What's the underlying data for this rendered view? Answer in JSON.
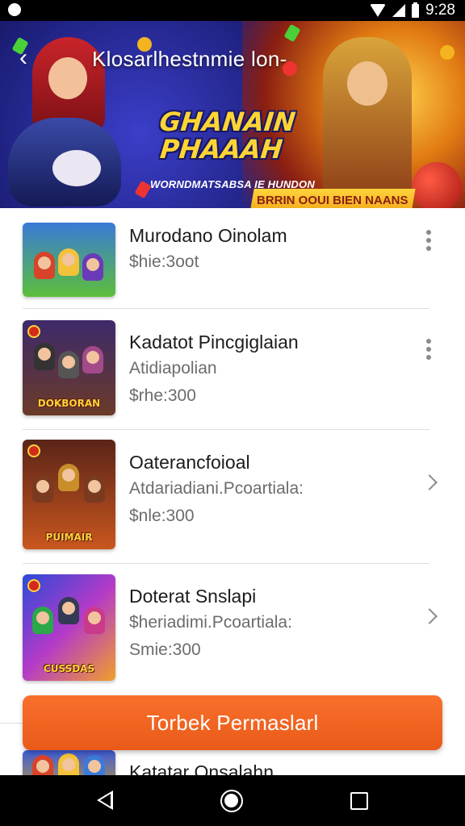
{
  "status_bar": {
    "time": "9:28"
  },
  "banner": {
    "title": "Klosarlhestnmie lon-",
    "logo_line1": "GHANAIN",
    "logo_line2": "PHAAAH",
    "tagline": "WORNDMATSABSA IE HUNDON",
    "ribbon": "BRRIN OOUI BIEN NAANS"
  },
  "games": [
    {
      "title": "Murodano Oinolam",
      "line2": "$hie:3oot",
      "line3": "",
      "thumb_caption": "",
      "action_icon": "more-vert-icon"
    },
    {
      "title": "Kadatot Pincgiglaian",
      "line2": "Atidiapolian",
      "line3": "$rhe:300",
      "thumb_caption": "DOKBORAN",
      "action_icon": "more-vert-icon"
    },
    {
      "title": "Oaterancfoioal",
      "line2": "Atdariadiani.Pcoartiala:",
      "line3": "$nle:300",
      "thumb_caption": "PUIMAIR",
      "action_icon": "chevron-right-icon"
    },
    {
      "title": "Doterat Snslapi",
      "line2": "$heriadimi.Pcoartiala:",
      "line3": "Smie:300",
      "thumb_caption": "CUSSDAS",
      "action_icon": "chevron-right-icon"
    },
    {
      "title": "Katatar Onsalahn",
      "line2": "",
      "line3": "",
      "thumb_caption": "",
      "action_icon": ""
    }
  ],
  "cta": {
    "label": "Torbek Permaslarl"
  },
  "colors": {
    "accent": "#f16424",
    "divider": "#dedede"
  }
}
